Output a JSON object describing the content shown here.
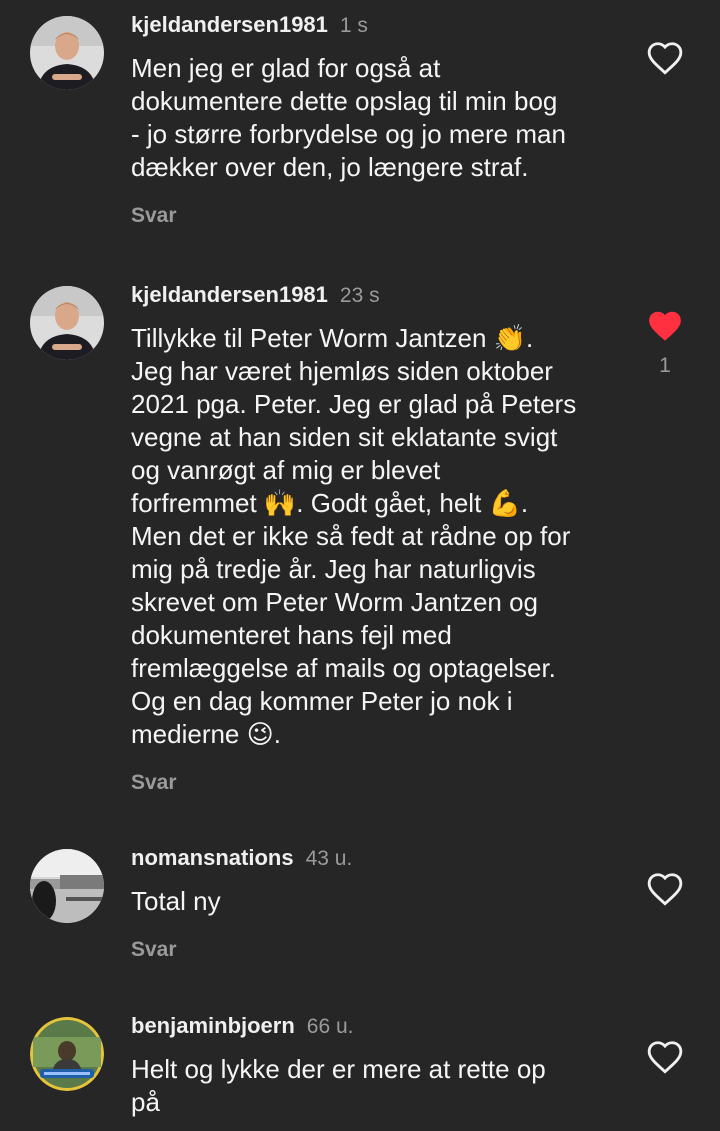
{
  "comments": [
    {
      "username": "kjeldandersen1981",
      "time": "1 s",
      "text": "Men jeg er glad for også at\ndokumentere dette opslag til min bog\n- jo større forbrydelse og jo mere man\ndækker over den, jo længere straf.",
      "reply": "Svar",
      "liked": false,
      "like_count": "",
      "avatar_icon": "man-portrait-avatar"
    },
    {
      "username": "kjeldandersen1981",
      "time": "23 s",
      "text": "Tillykke til Peter Worm Jantzen 👏.\nJeg har været hjemløs siden oktober\n2021 pga. Peter. Jeg er glad på Peters\nvegne at han siden sit eklatante svigt\nog vanrøgt af mig er blevet\nforfremmet 🙌. Godt gået, helt 💪.\nMen det er ikke så fedt at rådne op for\nmig på tredje år. Jeg har naturligvis\nskrevet om Peter Worm Jantzen og\ndokumenteret hans fejl med\nfremlæggelse af mails og optagelser.\nOg en dag kommer Peter jo nok i\nmedierne 😉.",
      "reply": "Svar",
      "liked": true,
      "like_count": "1",
      "avatar_icon": "man-portrait-avatar"
    },
    {
      "username": "nomansnations",
      "time": "43 u.",
      "text": "Total ny",
      "reply": "Svar",
      "liked": false,
      "like_count": "",
      "avatar_icon": "bw-photo-avatar"
    },
    {
      "username": "benjaminbjoern",
      "time": "66 u.",
      "text": "Helt og lykke der er mere at rette op\npå",
      "reply": "",
      "liked": false,
      "like_count": "",
      "avatar_icon": "outdoor-photo-avatar"
    }
  ],
  "colors": {
    "background": "#262626",
    "text": "#f5f5f5",
    "muted": "#9a9a9a",
    "heart_liked": "#ff3040"
  }
}
